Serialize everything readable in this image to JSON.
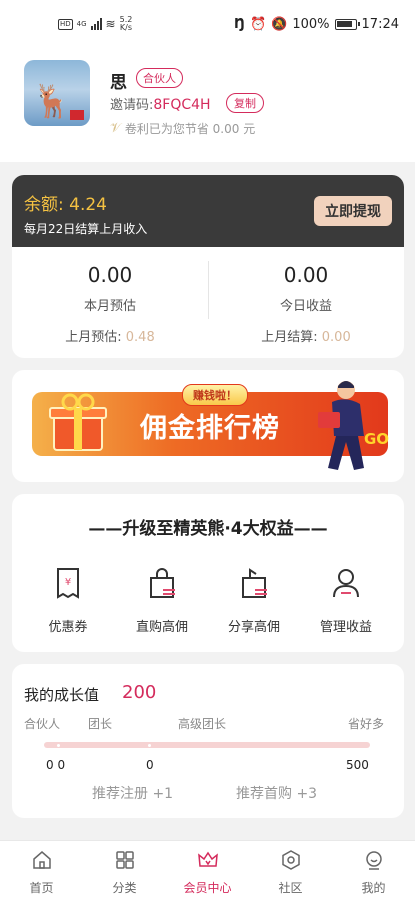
{
  "status_bar": {
    "network": "4G",
    "speed_value": "5.2",
    "speed_unit": "K/s",
    "battery": "100%",
    "time": "17:24"
  },
  "profile": {
    "name": "思",
    "tag": "合伙人",
    "invite_label": "邀请码:",
    "invite_code": "8FQC4H",
    "copy_label": "复制",
    "saved_text": "卷利已为您节省 0.00 元"
  },
  "balance": {
    "amount_text": "余额: 4.24",
    "note": "每月22日结算上月收入",
    "withdraw_label": "立即提现",
    "stats": [
      {
        "value": "0.00",
        "label": "本月预估",
        "prev_label": "上月预估: ",
        "prev_value": "0.48"
      },
      {
        "value": "0.00",
        "label": "今日收益",
        "prev_label": "上月结算: ",
        "prev_value": "0.00"
      }
    ]
  },
  "banner": {
    "pill": "赚钱啦！",
    "title": "佣金排行榜",
    "go": "GO"
  },
  "benefits": {
    "title": "——升级至精英熊·4大权益——",
    "items": [
      {
        "label": "优惠券",
        "icon": "coupon-icon"
      },
      {
        "label": "直购高佣",
        "icon": "shopping-bag-icon"
      },
      {
        "label": "分享高佣",
        "icon": "share-bag-icon"
      },
      {
        "label": "管理收益",
        "icon": "user-icon"
      }
    ]
  },
  "growth": {
    "title": "我的成长值",
    "value": "200",
    "levels": [
      "合伙人",
      "团长",
      "高级团长",
      "省好多"
    ],
    "numbers": [
      "0 0",
      "0",
      "500"
    ],
    "tips": [
      "推荐注册 +1",
      "推荐首购 +3"
    ],
    "track_color": "#f6d3d3"
  },
  "tabbar": {
    "items": [
      {
        "label": "首页",
        "icon": "home-icon"
      },
      {
        "label": "分类",
        "icon": "grid-icon"
      },
      {
        "label": "会员中心",
        "icon": "crown-icon",
        "active": true
      },
      {
        "label": "社区",
        "icon": "community-icon"
      },
      {
        "label": "我的",
        "icon": "profile-icon"
      }
    ],
    "active_color": "#d42b5c"
  }
}
